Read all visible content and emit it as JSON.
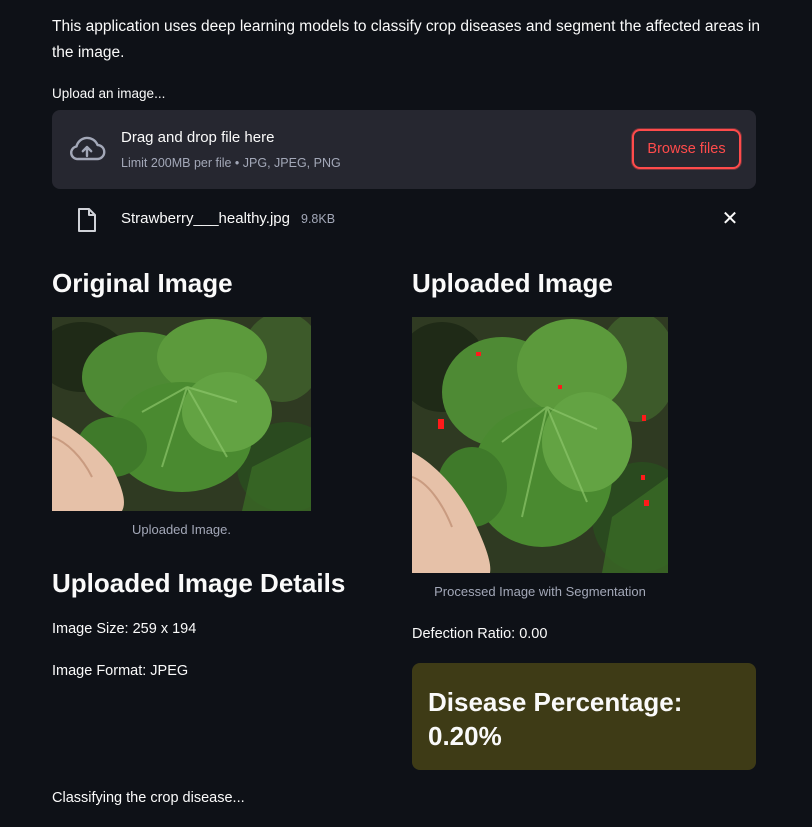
{
  "intro": "This application uses deep learning models to classify crop diseases and segment the affected areas in the image.",
  "uploader": {
    "label": "Upload an image...",
    "drag_drop_text": "Drag and drop file here",
    "limit_text": "Limit 200MB per file • JPG, JPEG, PNG",
    "browse_label": "Browse files",
    "file_name": "Strawberry___healthy.jpg",
    "file_size": "9.8KB",
    "remove_symbol": "✕"
  },
  "original": {
    "heading": "Original Image",
    "caption": "Uploaded Image."
  },
  "processed": {
    "heading": "Uploaded Image",
    "caption": "Processed Image with Segmentation"
  },
  "details": {
    "heading": "Uploaded Image Details",
    "image_size": "Image Size: 259 x 194",
    "image_format": "Image Format: JPEG"
  },
  "results": {
    "defection_ratio": "Defection Ratio: 0.00",
    "disease_percentage": "Disease Percentage: 0.20%"
  },
  "status": "Classifying the crop disease...",
  "colors": {
    "background": "#0e1117",
    "panel": "#262730",
    "accent": "#ff4b4b",
    "warning_box": "#3e3b16",
    "muted_text": "#a3a8b8"
  }
}
